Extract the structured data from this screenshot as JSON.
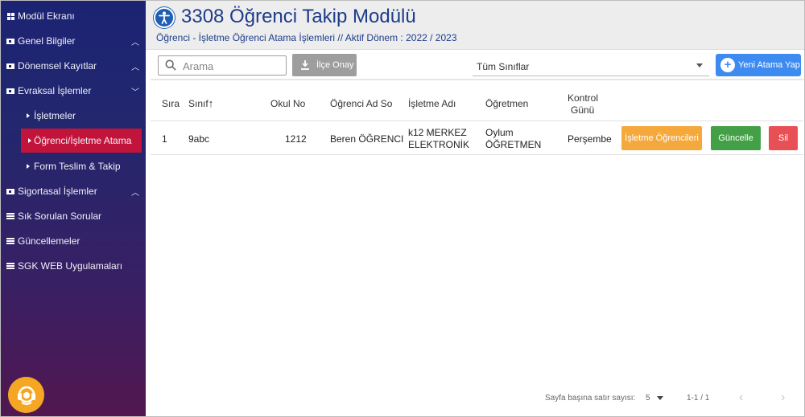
{
  "sidebar": {
    "items": [
      {
        "label": "Modül Ekranı",
        "icon": "grid-icon"
      },
      {
        "label": "Genel Bilgiler",
        "icon": "car-icon",
        "chevron": "up"
      },
      {
        "label": "Dönemsel Kayıtlar",
        "icon": "car-icon",
        "chevron": "up"
      },
      {
        "label": "Evraksal İşlemler",
        "icon": "car-icon",
        "chevron": "down"
      },
      {
        "label": "İşletmeler",
        "icon": "caret-right-icon"
      },
      {
        "label": "Öğrenci/İşletme Atama",
        "icon": "caret-right-icon",
        "active": true
      },
      {
        "label": "Form Teslim & Takip",
        "icon": "caret-right-icon"
      },
      {
        "label": "Sigortasal İşlemler",
        "icon": "car-icon",
        "chevron": "up"
      },
      {
        "label": "Sık Sorulan Sorular",
        "icon": "list-icon"
      },
      {
        "label": "Güncellemeler",
        "icon": "list-icon"
      },
      {
        "label": "SGK WEB Uygulamaları",
        "icon": "list-icon"
      }
    ],
    "active_color": "#c2143a",
    "support_icon": "headset-icon"
  },
  "header": {
    "title": "3308 Öğrenci Takip Modülü",
    "subtitle": "Öğrenci - İşletme Öğrenci Atama İşlemleri  // Aktif Dönem : 2022 / 2023",
    "logo_icon": "accessibility-icon"
  },
  "toolbar": {
    "search_placeholder": "Arama",
    "approve_label": "İlçe Onay",
    "class_select_value": "Tüm Sınıflar",
    "new_assignment_label": "Yeni Atama Yap"
  },
  "table": {
    "columns": [
      "Sıra",
      "Sınıf",
      "Okul No",
      "Öğrenci Ad So",
      "İşletme Adı",
      "Öğretmen",
      "Kontrol",
      "Günü"
    ],
    "sort_column": "Sınıf",
    "rows": [
      {
        "sira": "1",
        "sinif": "9abc",
        "okul_no": "1212",
        "ogrenci": "Beren ÖĞRENCI",
        "isletme_1": "k12 MERKEZ",
        "isletme_2": "ELEKTRONİK",
        "ogretmen_1": "Oylum",
        "ogretmen_2": "ÖĞRETMEN",
        "kontrol_gunu": "Perşembe",
        "actions": {
          "students": "İşletme Öğrencileri",
          "update": "Güncelle",
          "delete": "Sil"
        }
      }
    ]
  },
  "footer": {
    "rows_per_page_label": "Sayfa başına satır sayısı:",
    "rows_per_page": "5",
    "range": "1-1 / 1"
  },
  "colors": {
    "orange": "#f5a93c",
    "green": "#43a047",
    "red": "#e85055",
    "blue": "#3d8bf0",
    "title": "#1d3c8a"
  }
}
